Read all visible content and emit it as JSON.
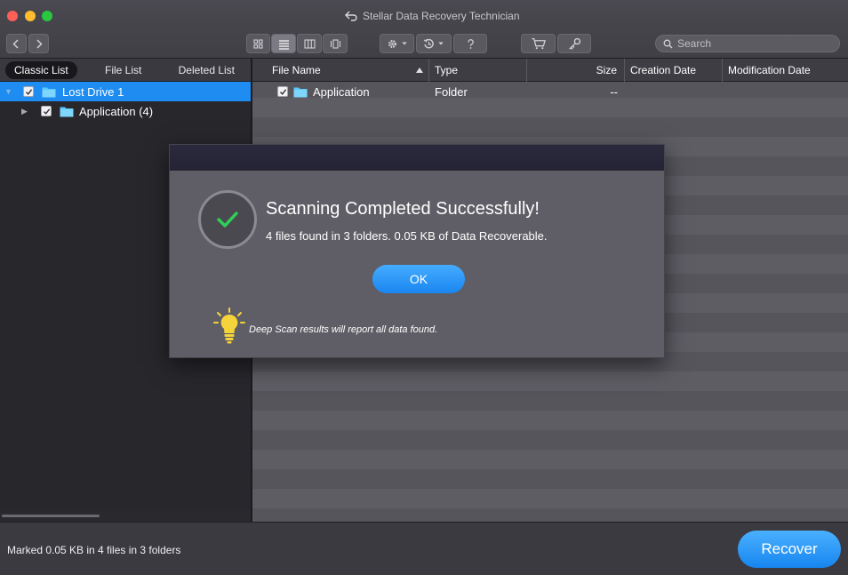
{
  "window": {
    "title": "Stellar Data Recovery Technician"
  },
  "search": {
    "placeholder": "Search"
  },
  "left_tabs": [
    "Classic List",
    "File List",
    "Deleted List"
  ],
  "tree": [
    {
      "label": "Lost Drive 1"
    },
    {
      "label": "Application (4)"
    }
  ],
  "table": {
    "headers": [
      "File Name",
      "Type",
      "Size",
      "Creation Date",
      "Modification Date"
    ],
    "rows": [
      {
        "name": "Application",
        "type": "Folder",
        "size": "--",
        "created": "",
        "modified": ""
      }
    ]
  },
  "status": {
    "text": "Marked 0.05 KB in 4 files in 3 folders"
  },
  "recover_label": "Recover",
  "modal": {
    "title": "Scanning Completed Successfully!",
    "message": "4 files found in 3 folders. 0.05 KB of Data Recoverable.",
    "ok_label": "OK",
    "tip": "Deep Scan results will report all data found."
  },
  "colors": {
    "accent": "#1e8cf0",
    "check": "#2ed158",
    "folder": "#5ac8fa",
    "bulb": "#f5d33a"
  }
}
